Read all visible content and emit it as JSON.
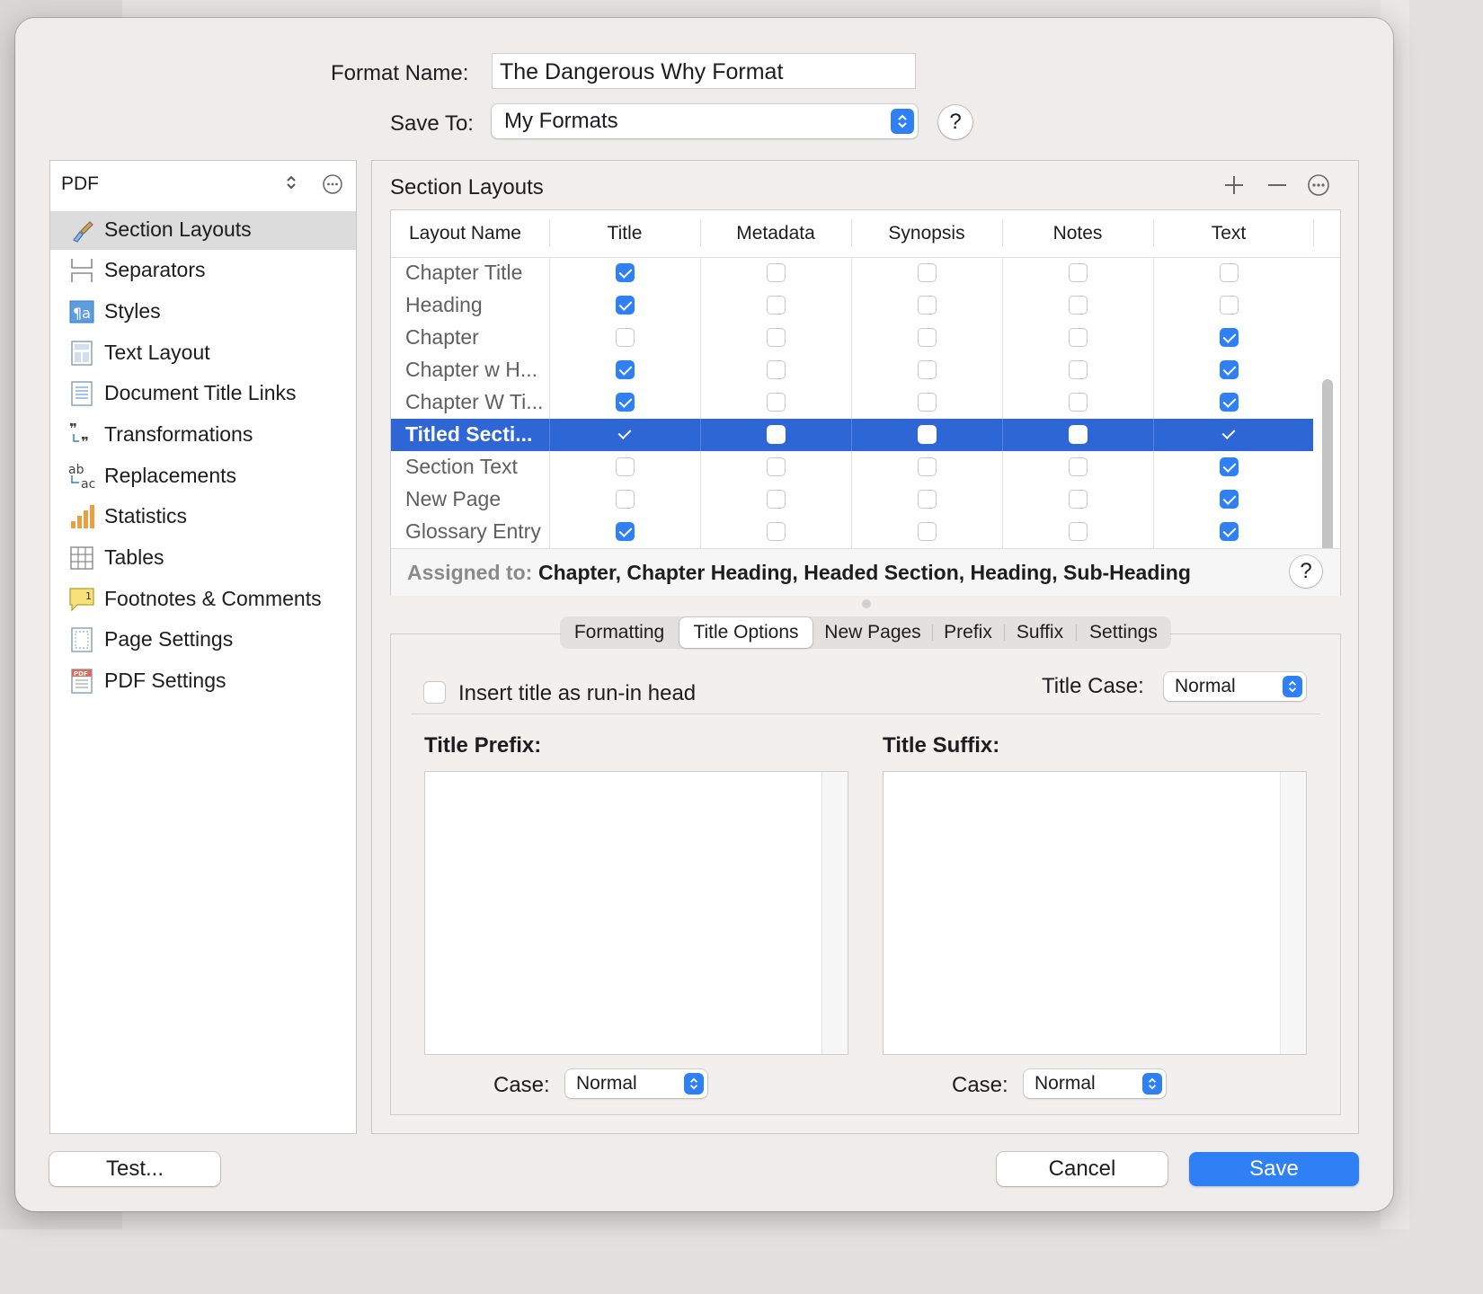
{
  "format": {
    "name_label": "Format Name:",
    "name_value": "The Dangerous Why Format",
    "save_to_label": "Save To:",
    "save_to_value": "My Formats",
    "help": "?"
  },
  "sidebar": {
    "format_type": "PDF",
    "items": [
      {
        "label": "Section Layouts",
        "icon": "paintbrush-icon",
        "selected": true
      },
      {
        "label": "Separators",
        "icon": "separators-icon"
      },
      {
        "label": "Styles",
        "icon": "styles-icon"
      },
      {
        "label": "Text Layout",
        "icon": "text-layout-icon"
      },
      {
        "label": "Document Title Links",
        "icon": "document-links-icon"
      },
      {
        "label": "Transformations",
        "icon": "transformations-icon"
      },
      {
        "label": "Replacements",
        "icon": "replacements-icon"
      },
      {
        "label": "Statistics",
        "icon": "statistics-icon"
      },
      {
        "label": "Tables",
        "icon": "tables-icon"
      },
      {
        "label": "Footnotes & Comments",
        "icon": "footnotes-icon"
      },
      {
        "label": "Page Settings",
        "icon": "page-settings-icon"
      },
      {
        "label": "PDF Settings",
        "icon": "pdf-settings-icon"
      }
    ]
  },
  "section_layouts": {
    "title": "Section Layouts",
    "columns": [
      "Layout Name",
      "Title",
      "Metadata",
      "Synopsis",
      "Notes",
      "Text"
    ],
    "rows": [
      {
        "name": "Chapter Title",
        "checks": [
          true,
          false,
          false,
          false,
          false
        ]
      },
      {
        "name": "Heading",
        "checks": [
          true,
          false,
          false,
          false,
          false
        ]
      },
      {
        "name": "Chapter",
        "checks": [
          false,
          false,
          false,
          false,
          true
        ]
      },
      {
        "name": "Chapter w H...",
        "checks": [
          true,
          false,
          false,
          false,
          true
        ]
      },
      {
        "name": "Chapter W Ti...",
        "checks": [
          true,
          false,
          false,
          false,
          true
        ]
      },
      {
        "name": "Titled Secti...",
        "checks": [
          true,
          false,
          false,
          false,
          true
        ],
        "selected": true
      },
      {
        "name": "Section Text",
        "checks": [
          false,
          false,
          false,
          false,
          true
        ]
      },
      {
        "name": "New Page",
        "checks": [
          false,
          false,
          false,
          false,
          true
        ]
      },
      {
        "name": "Glossary Entry",
        "checks": [
          true,
          false,
          false,
          false,
          true
        ]
      }
    ],
    "assigned_label": "Assigned to:",
    "assigned_value": "Chapter, Chapter Heading, Headed Section, Heading, Sub-Heading"
  },
  "tabs": {
    "items": [
      "Formatting",
      "Title Options",
      "New Pages",
      "Prefix",
      "Suffix",
      "Settings"
    ],
    "active": "Title Options"
  },
  "title_options": {
    "run_in_label": "Insert title as run-in head",
    "title_case_label": "Title Case:",
    "title_case_value": "Normal",
    "prefix_label": "Title Prefix:",
    "suffix_label": "Title Suffix:",
    "case_label": "Case:",
    "prefix_case_value": "Normal",
    "suffix_case_value": "Normal"
  },
  "buttons": {
    "test": "Test...",
    "cancel": "Cancel",
    "save": "Save"
  },
  "colors": {
    "accent": "#2f7ff5",
    "selection": "#2e66d6"
  }
}
